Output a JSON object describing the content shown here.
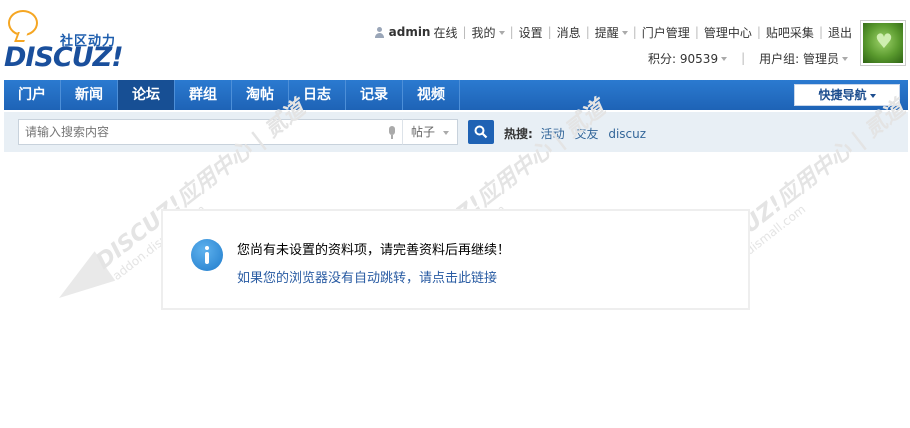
{
  "logo": {
    "tagline": "社区动力",
    "wordmark": "DISCUZ!"
  },
  "userbar": {
    "username": "admin",
    "status": "在线",
    "links": [
      "我的",
      "设置",
      "消息",
      "提醒",
      "门户管理",
      "管理中心",
      "贴吧采集",
      "退出"
    ]
  },
  "userbar2": {
    "points": "积分: 90539",
    "group": "用户组: 管理员"
  },
  "nav": {
    "items": [
      "门户",
      "新闻",
      "论坛",
      "群组",
      "淘帖",
      "日志",
      "记录",
      "视频"
    ],
    "active_index": 2,
    "quick_nav": "快捷导航"
  },
  "search": {
    "placeholder": "请输入搜索内容",
    "type": "帖子",
    "hot_label": "热搜:",
    "hot_words": [
      "活动",
      "交友",
      "discuz"
    ]
  },
  "watermark": {
    "title": "DISCUZ!应用中心 | 贰道",
    "url": "addon.dismall.com"
  },
  "message": {
    "text": "您尚有未设置的资料项，请完善资料后再继续！",
    "link": "如果您的浏览器没有自动跳转，请点击此链接"
  },
  "colors": {
    "nav_bg": "#2b7ad0",
    "nav_active": "#174f94",
    "search_bg": "#e8eff5",
    "link": "#2a5ca3"
  }
}
